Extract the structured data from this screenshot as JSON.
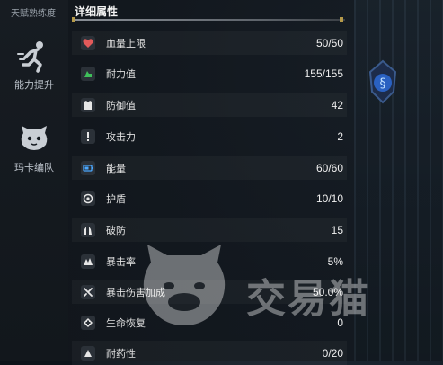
{
  "sidebar": {
    "top_label": "天赋熟练度",
    "items": [
      {
        "label": "能力提升",
        "icon": "running-figure-icon"
      },
      {
        "label": "玛卡编队",
        "icon": "creature-face-icon"
      }
    ]
  },
  "panel": {
    "title": "详细属性",
    "rows": [
      {
        "name": "血量上限",
        "value": "50/50",
        "icon": "heart-icon"
      },
      {
        "name": "耐力值",
        "value": "155/155",
        "icon": "stamina-icon"
      },
      {
        "name": "防御值",
        "value": "42",
        "icon": "armor-icon"
      },
      {
        "name": "攻击力",
        "value": "2",
        "icon": "exclamation-icon"
      },
      {
        "name": "能量",
        "value": "60/60",
        "icon": "battery-icon"
      },
      {
        "name": "护盾",
        "value": "10/10",
        "icon": "shield-ring-icon"
      },
      {
        "name": "破防",
        "value": "15",
        "icon": "break-icon"
      },
      {
        "name": "暴击率",
        "value": "5%",
        "icon": "crit-rate-icon"
      },
      {
        "name": "暴击伤害加成",
        "value": "50.0%",
        "icon": "crit-damage-icon"
      },
      {
        "name": "生命恢复",
        "value": "0",
        "icon": "regen-icon"
      },
      {
        "name": "耐药性",
        "value": "0/20",
        "icon": "resistance-icon"
      }
    ]
  },
  "watermark": {
    "text": "交易猫"
  },
  "colors": {
    "accent_gold": "#b59a4a",
    "heart_red": "#e25a5a",
    "stamina_green": "#3fbf5a",
    "energy_blue": "#4aa8ff"
  }
}
